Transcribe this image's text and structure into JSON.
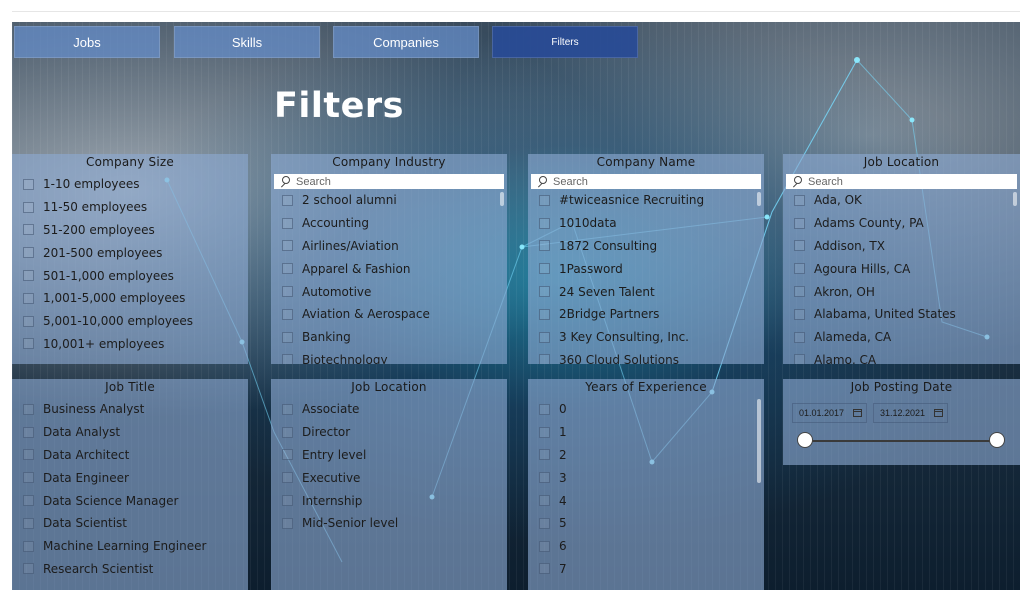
{
  "nav": {
    "buttons": [
      {
        "label": "Jobs"
      },
      {
        "label": "Skills"
      },
      {
        "label": "Companies"
      },
      {
        "label": "Filters"
      }
    ]
  },
  "page_title": "Filters",
  "search_placeholder": "Search",
  "panels": {
    "company_size": {
      "title": "Company Size",
      "items": [
        "1-10 employees",
        "11-50 employees",
        "51-200 employees",
        "201-500 employees",
        "501-1,000 employees",
        "1,001-5,000 employees",
        "5,001-10,000 employees",
        "10,001+ employees"
      ]
    },
    "company_industry": {
      "title": "Company Industry",
      "items": [
        "2 school alumni",
        "Accounting",
        "Airlines/Aviation",
        "Apparel & Fashion",
        "Automotive",
        "Aviation & Aerospace",
        "Banking",
        "Biotechnology"
      ]
    },
    "company_name": {
      "title": "Company Name",
      "items": [
        "#twiceasnice Recruiting",
        "1010data",
        "1872 Consulting",
        "1Password",
        "24 Seven Talent",
        "2Bridge Partners",
        "3 Key Consulting, Inc.",
        "360 Cloud Solutions"
      ]
    },
    "job_location_top": {
      "title": "Job Location",
      "items": [
        "Ada, OK",
        "Adams County, PA",
        "Addison, TX",
        "Agoura Hills, CA",
        "Akron, OH",
        "Alabama, United States",
        "Alameda, CA",
        "Alamo, CA"
      ]
    },
    "job_title": {
      "title": "Job Title",
      "items": [
        "Business Analyst",
        "Data Analyst",
        "Data Architect",
        "Data Engineer",
        "Data Science Manager",
        "Data Scientist",
        "Machine Learning Engineer",
        "Research Scientist"
      ]
    },
    "job_location_level": {
      "title": "Job Location",
      "items": [
        "Associate",
        "Director",
        "Entry level",
        "Executive",
        "Internship",
        "Mid-Senior level"
      ]
    },
    "years_experience": {
      "title": "Years of Experience",
      "items": [
        "0",
        "1",
        "2",
        "3",
        "4",
        "5",
        "6",
        "7"
      ]
    },
    "job_posting_date": {
      "title": "Job Posting Date",
      "start": "01.01.2017",
      "end": "31.12.2021",
      "range_start_fraction": 0,
      "range_end_fraction": 1
    }
  }
}
